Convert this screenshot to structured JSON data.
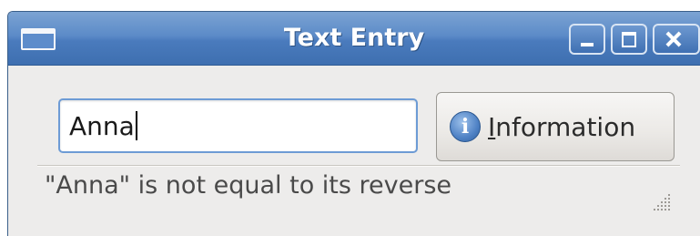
{
  "window": {
    "title": "Text Entry",
    "controls": [
      "minimize",
      "maximize",
      "close"
    ]
  },
  "entry": {
    "value": "Anna",
    "has_focus": true
  },
  "info_button": {
    "label_mnemonic": "I",
    "label_rest": "nformation",
    "icon": "info-icon"
  },
  "status": {
    "text": "\"Anna\" is not equal to its reverse"
  },
  "colors": {
    "titlebar": "#4a7bbd",
    "window_bg": "#edeceb",
    "entry_focus_border": "#6d9bd5",
    "info_icon": "#4f82c5"
  }
}
